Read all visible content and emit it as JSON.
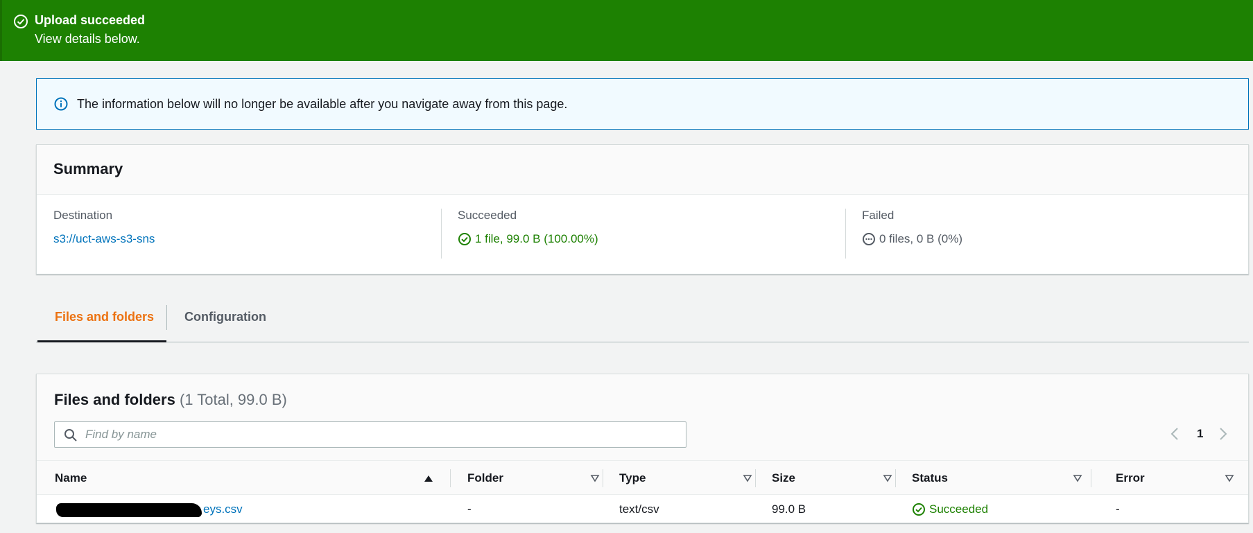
{
  "flash": {
    "title": "Upload succeeded",
    "subtitle": "View details below.",
    "icon": "check-circle-icon",
    "color": "#1d8102"
  },
  "info": {
    "text": "The information below will no longer be available after you navigate away from this page.",
    "icon": "info-icon"
  },
  "summary": {
    "title": "Summary",
    "destination": {
      "label": "Destination",
      "value": "s3://uct-aws-s3-sns"
    },
    "succeeded": {
      "label": "Succeeded",
      "value": "1 file, 99.0 B (100.00%)"
    },
    "failed": {
      "label": "Failed",
      "value": "0 files, 0 B (0%)"
    }
  },
  "tabs": [
    {
      "label": "Files and folders",
      "active": true
    },
    {
      "label": "Configuration",
      "active": false
    }
  ],
  "files": {
    "title": "Files and folders",
    "count": "(1 Total, 99.0 B)",
    "search_placeholder": "Find by name",
    "page": "1",
    "columns": [
      "Name",
      "Folder",
      "Type",
      "Size",
      "Status",
      "Error"
    ],
    "rows": [
      {
        "name": "eys.csv",
        "folder": "-",
        "type": "text/csv",
        "size": "99.0 B",
        "status": "Succeeded",
        "error": "-"
      }
    ]
  },
  "colors": {
    "success": "#1d8102",
    "link": "#0073bb",
    "active_tab": "#ec7211"
  }
}
